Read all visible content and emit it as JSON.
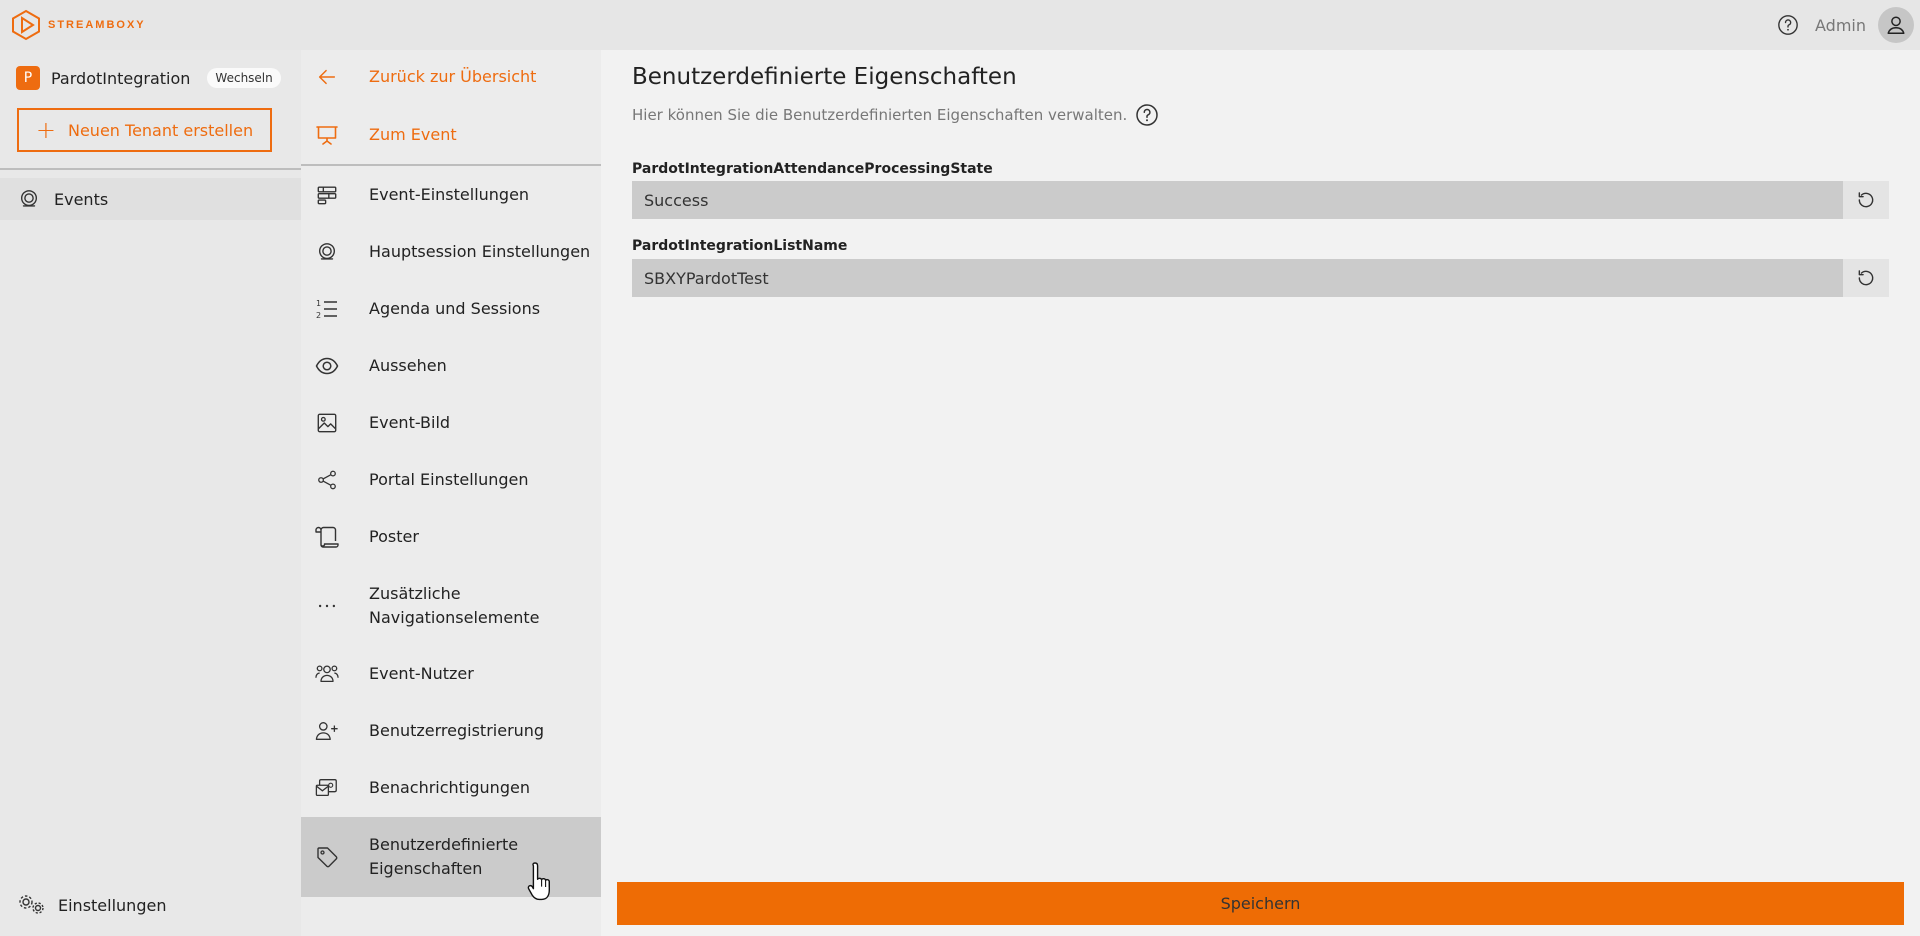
{
  "brand": {
    "name": "STREAMBOXY",
    "accent": "#ee6c10"
  },
  "header": {
    "user_label": "Admin"
  },
  "tenant": {
    "initial": "P",
    "name": "PardotIntegration",
    "switch_label": "Wechseln"
  },
  "left_nav": {
    "new_tenant_label": "Neuen Tenant erstellen",
    "events_label": "Events",
    "settings_label": "Einstellungen"
  },
  "mid_nav": {
    "back_label": "Zurück zur Übersicht",
    "to_event_label": "Zum Event",
    "items": [
      {
        "label": "Event-Einstellungen",
        "icon": "layout-icon"
      },
      {
        "label": "Hauptsession Einstellungen",
        "icon": "webcam-icon"
      },
      {
        "label": "Agenda und Sessions",
        "icon": "numbered-list-icon"
      },
      {
        "label": "Aussehen",
        "icon": "eye-icon"
      },
      {
        "label": "Event-Bild",
        "icon": "image-icon"
      },
      {
        "label": "Portal Einstellungen",
        "icon": "share-icon"
      },
      {
        "label": "Poster",
        "icon": "scroll-icon"
      },
      {
        "label": "Zusätzliche Navigationselemente",
        "icon": "more-icon"
      },
      {
        "label": "Event-Nutzer",
        "icon": "users-icon"
      },
      {
        "label": "Benutzerregistrierung",
        "icon": "user-plus-icon"
      },
      {
        "label": "Benachrichtigungen",
        "icon": "mail-icon"
      },
      {
        "label": "Benutzerdefinierte Eigenschaften",
        "icon": "tag-icon",
        "active": true
      }
    ]
  },
  "main": {
    "title": "Benutzerdefinierte Eigenschaften",
    "subtitle": "Hier können Sie die Benutzerdefinierten Eigenschaften verwalten.",
    "fields": [
      {
        "label": "PardotIntegrationAttendanceProcessingState",
        "value": "Success"
      },
      {
        "label": "PardotIntegrationListName",
        "value": "SBXYPardotTest"
      }
    ],
    "save_label": "Speichern"
  }
}
